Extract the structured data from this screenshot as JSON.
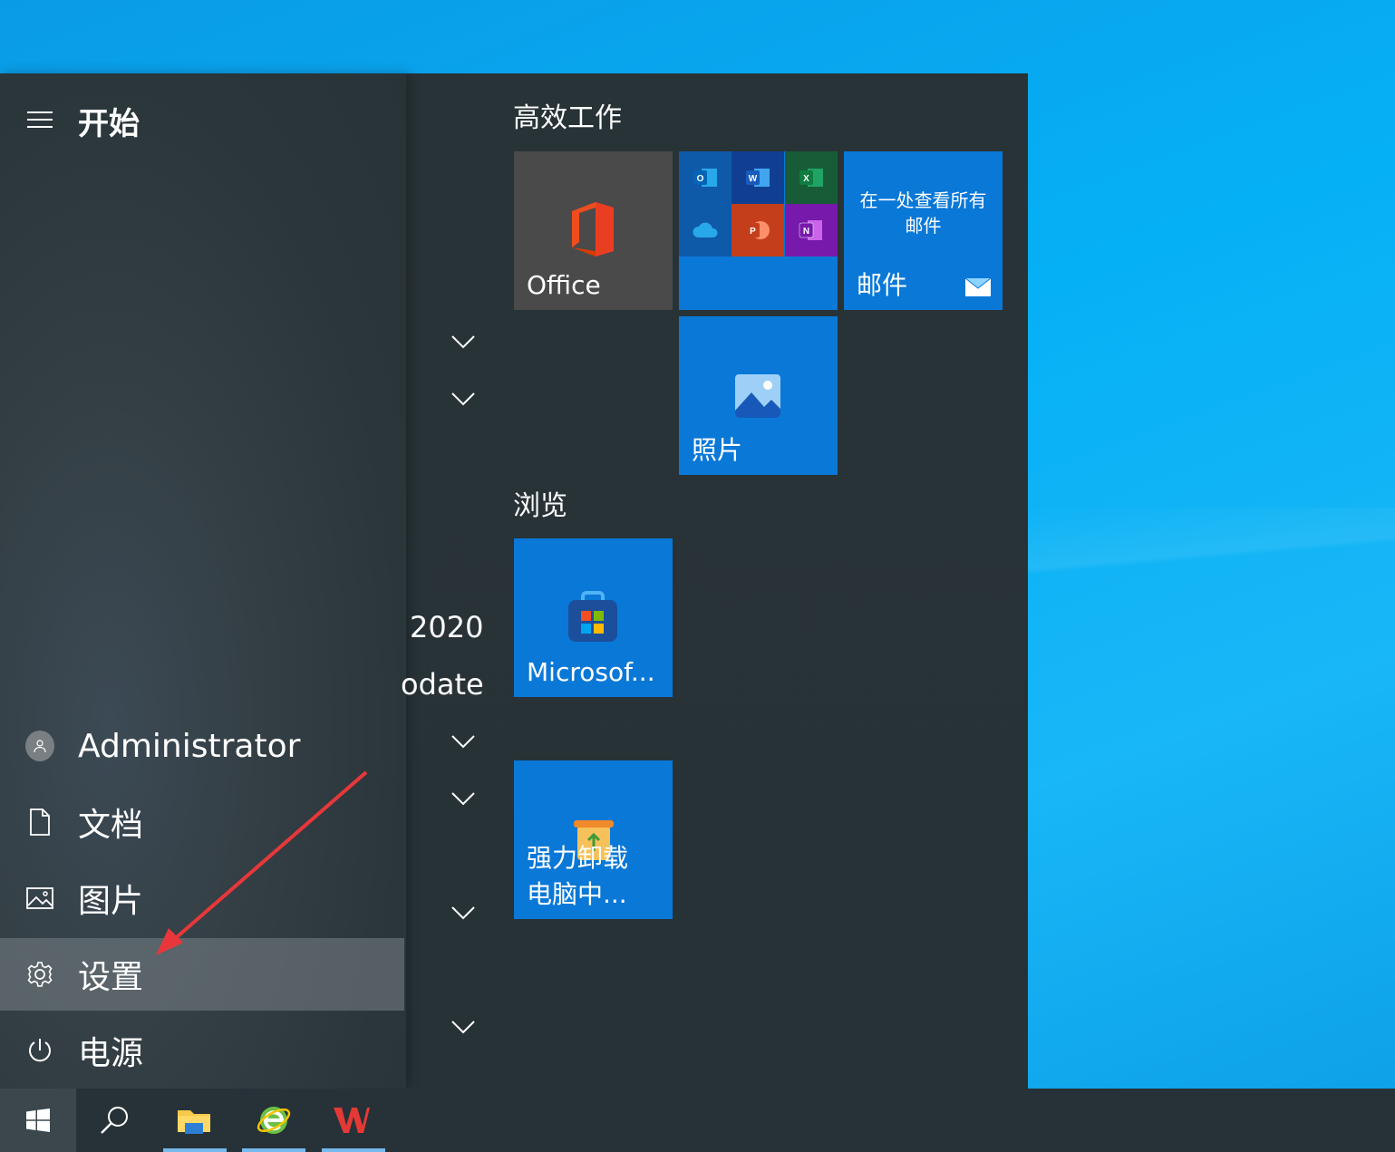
{
  "start": {
    "title": "开始",
    "user": "Administrator",
    "documents": "文档",
    "pictures": "图片",
    "settings": "设置",
    "power": "电源"
  },
  "app_list_fragments": {
    "item1": "2020",
    "item2": "odate"
  },
  "groups": {
    "productivity": "高效工作",
    "browse": "浏览"
  },
  "tiles": {
    "office": "Office",
    "mail_desc": "在一处查看所有邮件",
    "mail": "邮件",
    "photos": "照片",
    "store": "Microsof...",
    "uninstall_line1": "强力卸载",
    "uninstall_line2": "电脑中..."
  },
  "colors": {
    "tile_blue": "#0a78d7",
    "annotation_arrow": "#e8373a"
  }
}
